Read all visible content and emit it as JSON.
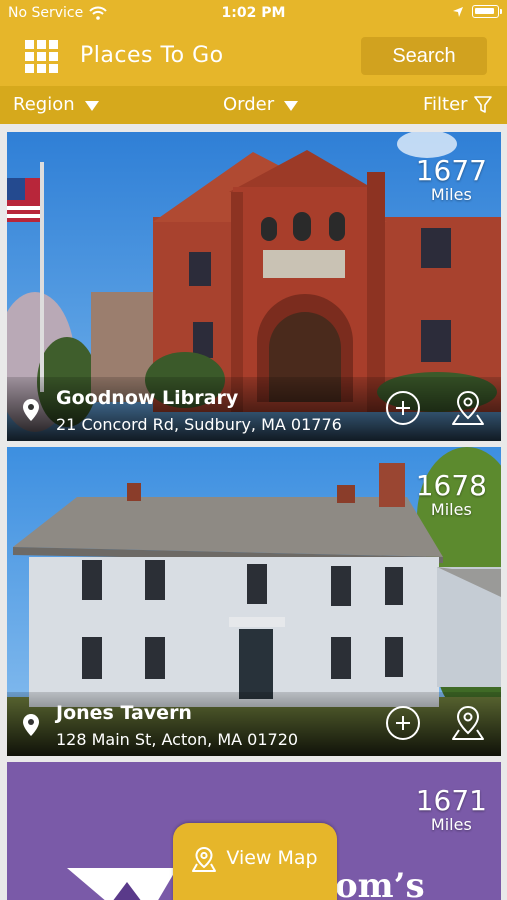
{
  "status_bar": {
    "carrier": "No Service",
    "time": "1:02 PM"
  },
  "header": {
    "title": "Places To Go",
    "search_label": "Search"
  },
  "filters": {
    "region_label": "Region",
    "order_label": "Order",
    "filter_label": "Filter"
  },
  "places": [
    {
      "name": "Goodnow Library",
      "address": "21 Concord Rd, Sudbury, MA 01776",
      "distance": "1677",
      "distance_unit": "Miles"
    },
    {
      "name": "Jones Tavern",
      "address": "128 Main St, Acton, MA 01720",
      "distance": "1678",
      "distance_unit": "Miles"
    },
    {
      "name": "",
      "address": "",
      "distance": "1671",
      "distance_unit": "Miles",
      "banner_text": "om’s"
    }
  ],
  "view_map_label": "View Map",
  "colors": {
    "brand_yellow": "#e6b62a",
    "filter_bar": "#d6a91c",
    "search_button": "#d1a21f",
    "purple_card": "#7a5aa8"
  },
  "icons": {
    "menu": "grid-icon",
    "wifi": "wifi-icon",
    "location_arrow": "location-arrow-icon",
    "battery": "battery-icon",
    "region_dropdown": "chevron-down-icon",
    "order_dropdown": "chevron-down-icon",
    "filter": "filter-funnel-icon",
    "place_pin": "location-pin-icon",
    "add": "plus-circle-icon",
    "map": "map-pin-icon"
  }
}
